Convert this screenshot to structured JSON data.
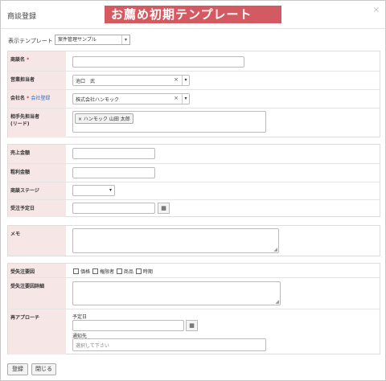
{
  "dialog": {
    "title": "商談登録",
    "banner": "お薦め初期テンプレート",
    "close_icon": "close-icon"
  },
  "template": {
    "label": "表示テンプレート",
    "selected": "案件管理サンプル"
  },
  "fields": {
    "deal_name": {
      "label": "商談名",
      "required": "*",
      "value": ""
    },
    "sales_rep": {
      "label": "営業担当者",
      "value": "池口　武",
      "clear": "×",
      "arrow": "▾"
    },
    "company": {
      "label": "会社名",
      "required": "*",
      "link": "会社登録",
      "value": "株式会社ハンモック",
      "clear": "×",
      "arrow": "▾"
    },
    "counterpart": {
      "label_line1": "相手先担当者",
      "label_line2": "(リード)",
      "tags": [
        "× ハンモック 山田 太郎"
      ]
    },
    "sales_amount": {
      "label": "売上金額",
      "value": ""
    },
    "gross_profit": {
      "label": "粗利金額",
      "value": ""
    },
    "stage": {
      "label": "商談ステージ",
      "value": "",
      "arrow": "▾"
    },
    "order_date": {
      "label": "受注予定日",
      "value": ""
    },
    "memo": {
      "label": "メモ",
      "value": ""
    },
    "lost_reason": {
      "label": "受失注要因",
      "options": [
        "価格",
        "権限者",
        "商品",
        "時期"
      ]
    },
    "lost_detail": {
      "label": "受失注要因詳細",
      "value": ""
    },
    "re_approach": {
      "label": "再アプローチ",
      "date_label": "予定日",
      "notify_label": "通知先",
      "notify_placeholder": "選択して下さい"
    }
  },
  "buttons": {
    "register": "登録",
    "close": "閉じる"
  },
  "icons": {
    "calendar": "▦",
    "resize": "◢"
  },
  "colors": {
    "label_bg": "#f7e6e6",
    "banner_bg": "#d45a61",
    "required": "#d0393e",
    "link": "#2c6fc1"
  }
}
